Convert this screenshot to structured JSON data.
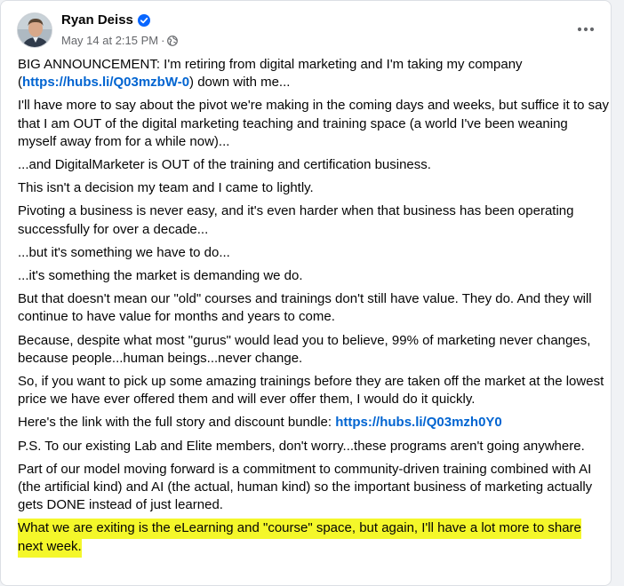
{
  "post": {
    "author": "Ryan Deiss",
    "timestamp": "May 14 at 2:15 PM",
    "separator": "·",
    "audience_icon": "globe-icon",
    "verified_icon": "verified-badge-icon",
    "more_icon": "more-options-icon",
    "paragraphs": {
      "p1_text": "BIG ANNOUNCEMENT: I'm retiring from digital marketing and I'm taking my company (",
      "p1_link": "https://hubs.li/Q03mzbW-0",
      "p1_tail": ") down with me...",
      "p2": "I'll have more to say about the pivot we're making in the coming days and weeks, but suffice it to say that I am OUT of the digital marketing teaching and training space (a world I've been weaning myself away from for a while now)...",
      "p3": "...and DigitalMarketer is OUT of the training and certification business.",
      "p4": "This isn't a decision my team and I came to lightly.",
      "p5": "Pivoting a business is never easy, and it's even harder when that business has been operating successfully for over a decade...",
      "p6": "...but it's something we have to do...",
      "p7": "...it's something the market is demanding we do.",
      "p8": "But that doesn't mean our \"old\" courses and trainings don't still have value. They do. And they will continue to have value for months and years to come.",
      "p9": "Because, despite what most \"gurus\" would lead you to believe, 99% of marketing never changes, because people...human beings...never change.",
      "p10": "So, if you want to pick up some amazing trainings before they are taken off the market at the lowest price we have ever offered them and will ever offer them, I would do it quickly.",
      "p11_text": "Here's the link with the full story and discount bundle: ",
      "p11_link": "https://hubs.li/Q03mzh0Y0",
      "p12": "P.S. To our existing Lab and Elite members, don't worry...these programs aren't going anywhere.",
      "p13": "Part of our model moving forward is a commitment to community-driven training combined with AI (the artificial kind) and AI (the actual, human kind) so the important business of marketing actually gets DONE instead of just learned.",
      "p14": "What we are exiting is the eLearning and \"course\" space, but again, I'll have a lot more to share next week."
    }
  },
  "colors": {
    "link": "#0064d1",
    "highlight": "#f4f72a",
    "verified": "#0866ff",
    "meta_text": "#65676b"
  }
}
